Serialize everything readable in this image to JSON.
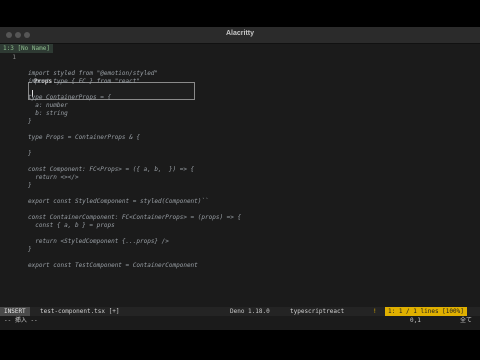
{
  "window": {
    "title": "Alacritty"
  },
  "buffer_tab": {
    "label": "1:3 [No Name]"
  },
  "popup": {
    "title": "Props"
  },
  "editor": {
    "current_line_number": "1",
    "lines": [
      "",
      "",
      "import styled from \"@emotion/styled\"",
      "import type { FC } from \"react\"",
      "",
      "type ContainerProps = {",
      "  a: number",
      "  b: string",
      "}",
      "",
      "type Props = ContainerProps & {",
      "",
      "}",
      "",
      "const Component: FC<Props> = ({ a, b,  }) => {",
      "  return <></>",
      "}",
      "",
      "export const StyledComponent = styled(Component)``",
      "",
      "const ContainerComponent: FC<ContainerProps> = (props) => {",
      "  const { a, b } = props",
      "",
      "  return <StyledComponent {...props} />",
      "}",
      "",
      "export const TestComponent = ContainerComponent"
    ]
  },
  "statusline": {
    "mode": "INSERT",
    "filename": "test-component.tsx [+]",
    "runtime": "Deno 1.18.0",
    "filetype": "typescriptreact",
    "warn_icon": "!",
    "position": "1: 1 / 1 lines [100%]"
  },
  "cmdline": {
    "mode": "-- 挿入 --",
    "position": "0,1",
    "scroll": "全て"
  }
}
